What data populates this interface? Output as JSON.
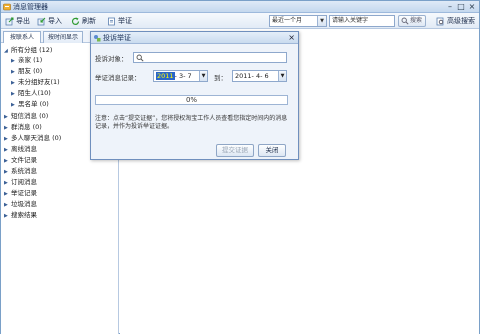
{
  "window": {
    "title": "消息管理器"
  },
  "toolbar": {
    "export_label": "导出",
    "import_label": "导入",
    "refresh_label": "刷新",
    "report_label": "举证",
    "period_select": "最近一个月",
    "search_placeholder": "请输入关键字",
    "search_button": "搜索",
    "advanced_search": "高级搜索"
  },
  "tabs": [
    {
      "label": "按联系人"
    },
    {
      "label": "按时间显示"
    }
  ],
  "tree": {
    "all_groups": "所有分组 (12)",
    "strangers_group": "陌生人(10)",
    "groups": [
      {
        "label": "亲家 (1)"
      },
      {
        "label": "朋友 (0)"
      },
      {
        "label": "未分组好友(1)"
      },
      {
        "label": "黑名单 (0)"
      }
    ],
    "sections": [
      {
        "label": "短信消息 (0)"
      },
      {
        "label": "群消息 (0)"
      },
      {
        "label": "多人聊天消息 (0)"
      },
      {
        "label": "离线消息"
      },
      {
        "label": "文件记录"
      },
      {
        "label": "系统消息"
      },
      {
        "label": "订阅消息"
      },
      {
        "label": "举证记录"
      },
      {
        "label": "垃圾消息"
      },
      {
        "label": "搜索结果"
      }
    ]
  },
  "dialog": {
    "title": "投诉举证",
    "target_label": "投诉对象：",
    "record_label": "举证消息记录：",
    "date_from_year": "2011",
    "date_from_rest": "- 3- 7",
    "to_label": "到：",
    "date_to": "2011- 4- 6",
    "progress_text": "0%",
    "progress_value": 0,
    "note": "注意：点击“提交证据”，您将授权淘宝工作人员查看您指定时间内的消息记录，并作为投诉举证证据。",
    "submit_label": "提交证据",
    "close_label": "关闭"
  },
  "colors": {
    "accent": "#2a66c9",
    "border": "#7aa0c8",
    "titlebar": "#c4d8ee"
  }
}
